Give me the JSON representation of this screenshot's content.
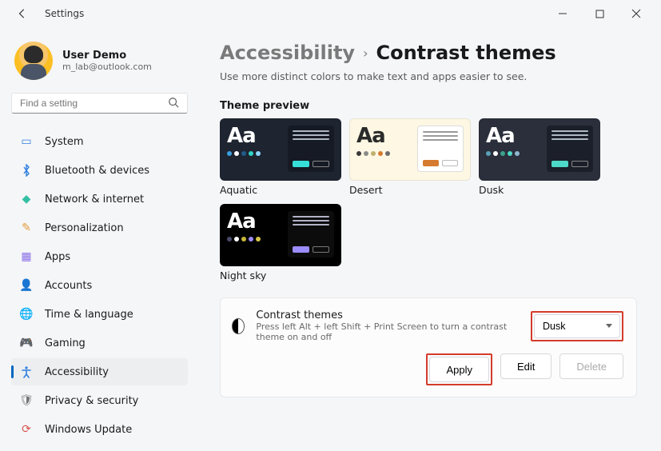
{
  "window": {
    "title": "Settings"
  },
  "user": {
    "name": "User Demo",
    "email": "m_lab@outlook.com"
  },
  "search": {
    "placeholder": "Find a setting"
  },
  "nav": {
    "items": [
      {
        "label": "System"
      },
      {
        "label": "Bluetooth & devices"
      },
      {
        "label": "Network & internet"
      },
      {
        "label": "Personalization"
      },
      {
        "label": "Apps"
      },
      {
        "label": "Accounts"
      },
      {
        "label": "Time & language"
      },
      {
        "label": "Gaming"
      },
      {
        "label": "Accessibility"
      },
      {
        "label": "Privacy & security"
      },
      {
        "label": "Windows Update"
      }
    ],
    "active_index": 8
  },
  "breadcrumb": {
    "parent": "Accessibility",
    "current": "Contrast themes"
  },
  "subtitle": "Use more distinct colors to make text and apps easier to see.",
  "preview": {
    "heading": "Theme preview",
    "themes": [
      {
        "name": "Aquatic",
        "variant": "t-aquatic",
        "dots": [
          "#3aa0e0",
          "#fff",
          "#1f5b8a",
          "#2fd4c6",
          "#8cd6ff"
        ]
      },
      {
        "name": "Desert",
        "variant": "t-desert",
        "dots": [
          "#3a3a3a",
          "#8a8a8a",
          "#c0b070",
          "#d57a2e",
          "#6c6c6c"
        ]
      },
      {
        "name": "Dusk",
        "variant": "t-dusk",
        "dots": [
          "#5aa0b8",
          "#fff",
          "#3aa38a",
          "#4dd9c8",
          "#8fb8d0"
        ]
      },
      {
        "name": "Night sky",
        "variant": "t-night",
        "dots": [
          "#4a4a6a",
          "#fff",
          "#c9b83a",
          "#9b8cff",
          "#d6c64a"
        ]
      }
    ]
  },
  "card": {
    "title": "Contrast themes",
    "hint": "Press left Alt + left Shift + Print Screen to turn a contrast theme on and off",
    "selected": "Dusk",
    "buttons": {
      "apply": "Apply",
      "edit": "Edit",
      "delete": "Delete"
    }
  }
}
